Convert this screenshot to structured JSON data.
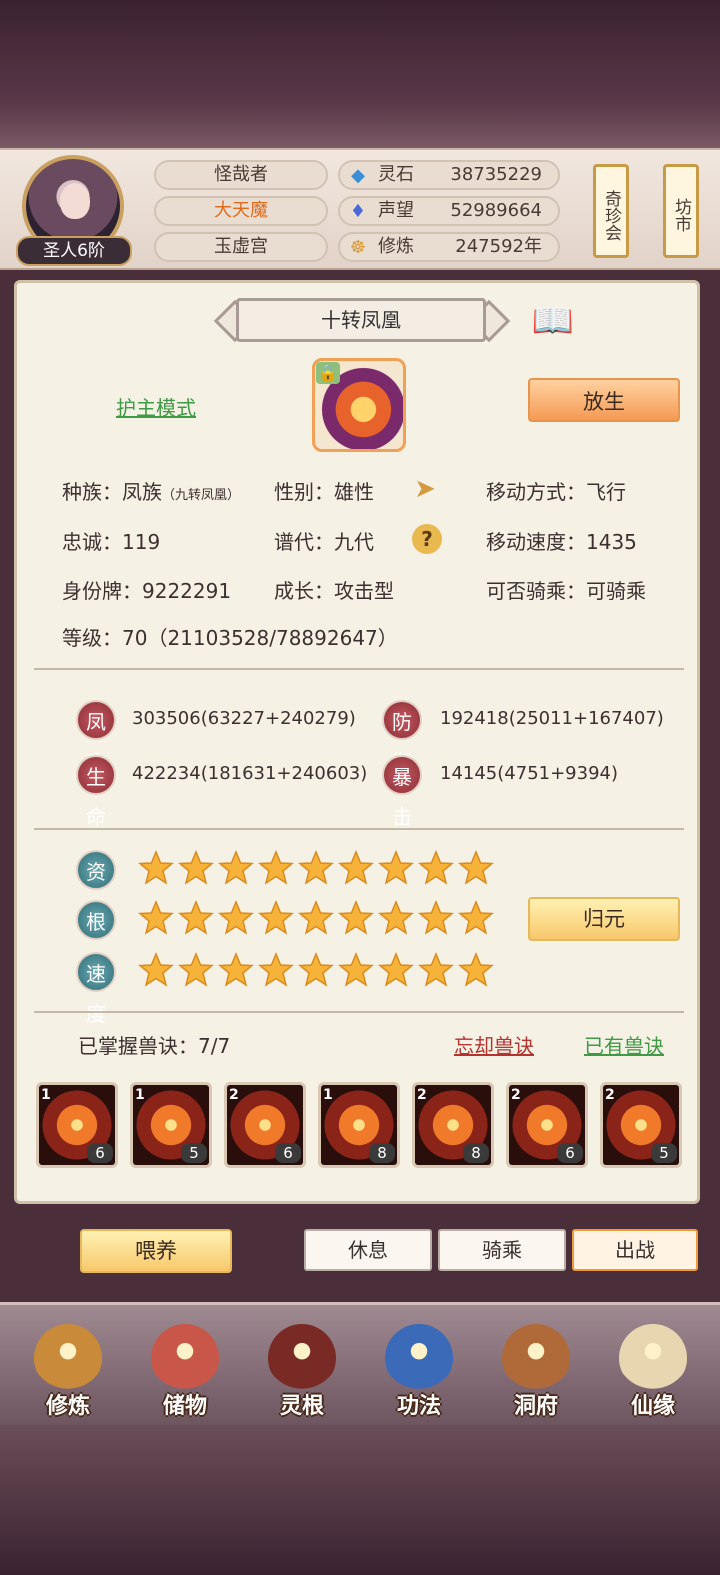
{
  "player": {
    "rank": "圣人6阶",
    "name": "怪哉者",
    "title": "大天魔",
    "sect": "玉虚宫"
  },
  "resources": [
    {
      "icon": "gem-icon",
      "label": "灵石",
      "value": "38735229"
    },
    {
      "icon": "reputation-crystal-icon",
      "label": "声望",
      "value": "52989664"
    },
    {
      "icon": "meditation-icon",
      "label": "修炼",
      "value": "247592年"
    }
  ],
  "header_buttons": {
    "treasure": "奇珍会",
    "market": "坊市"
  },
  "pet": {
    "name": "十转凤凰",
    "mode_link": "护主模式",
    "release_button": "放生",
    "info": {
      "race_label": "种族：凤族",
      "race_sub": "（九转凤凰）",
      "gender": "性别：雄性",
      "move_type": "移动方式：飞行",
      "loyalty": "忠诚：119",
      "generation": "谱代：九代",
      "move_speed": "移动速度：1435",
      "id_tag": "身份牌：9222291",
      "growth": "成长：攻击型",
      "rideable": "可否骑乘：可骑乘",
      "level": "等级：70（21103528/78892647）"
    },
    "stats": [
      {
        "badge": "凤攻",
        "value": "303506(63227+240279)"
      },
      {
        "badge": "防御",
        "value": "192418(25011+167407)"
      },
      {
        "badge": "生命",
        "value": "422234(181631+240603)"
      },
      {
        "badge": "暴击",
        "value": "14145(4751+9394)"
      }
    ],
    "aptitudes": [
      {
        "label": "资质",
        "stars": 9
      },
      {
        "label": "根骨",
        "stars": 9
      },
      {
        "label": "速度",
        "stars": 9
      }
    ],
    "restore_button": "归元",
    "skills_mastered": "已掌握兽诀：7/7",
    "forget_link": "忘却兽诀",
    "owned_link": "已有兽诀",
    "skills": [
      {
        "tier": "1",
        "level": "6"
      },
      {
        "tier": "1",
        "level": "5"
      },
      {
        "tier": "2",
        "level": "6"
      },
      {
        "tier": "1",
        "level": "8"
      },
      {
        "tier": "2",
        "level": "8"
      },
      {
        "tier": "2",
        "level": "6"
      },
      {
        "tier": "2",
        "level": "5"
      }
    ]
  },
  "actions": {
    "feed": "喂养",
    "rest": "休息",
    "ride": "骑乘",
    "battle": "出战"
  },
  "nav": [
    {
      "icon": "cultivation-icon",
      "label": "修炼"
    },
    {
      "icon": "storage-bag-icon",
      "label": "储物"
    },
    {
      "icon": "spirit-root-icon",
      "label": "灵根"
    },
    {
      "icon": "technique-book-icon",
      "label": "功法"
    },
    {
      "icon": "cave-mansion-icon",
      "label": "洞府"
    },
    {
      "icon": "fortune-gourd-icon",
      "label": "仙缘"
    }
  ],
  "colors": {
    "accent_orange": "#f59a54",
    "link_green": "#3f9a45",
    "link_red": "#b5332f",
    "title_orange": "#e06a1c"
  }
}
